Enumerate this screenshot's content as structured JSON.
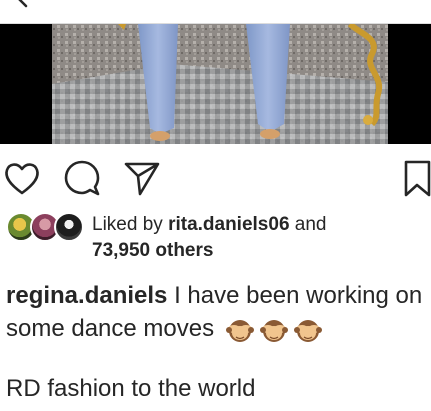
{
  "post": {
    "liked_by_prefix": "Liked by",
    "liked_by_user": "rita.daniels06",
    "liked_by_and": "and",
    "others_count": "73,950 others",
    "caption_user": "regina.daniels",
    "caption_text_1": "I have been working on some dance moves",
    "caption_emoji_name": "see-no-evil-monkey",
    "caption_emoji_count": 3,
    "caption_text_2": "RD fashion to the world"
  },
  "icons": {
    "like": "heart-icon",
    "comment": "comment-bubble-icon",
    "share": "paper-plane-icon",
    "save": "bookmark-icon",
    "back": "back-arrow-icon"
  }
}
